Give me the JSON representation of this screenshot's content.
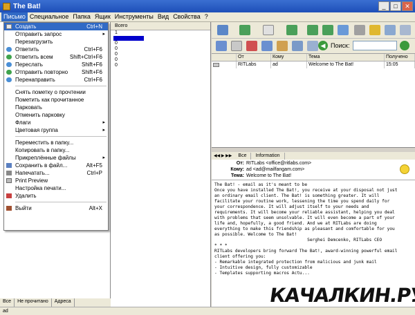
{
  "window": {
    "title": "The Bat!",
    "min": "_",
    "max": "□",
    "close": "✕"
  },
  "menubar": [
    "Письмо",
    "Специальное",
    "Папка",
    "Ящик",
    "Инструменты",
    "Вид",
    "Свойства",
    "?"
  ],
  "context_menu": [
    {
      "label": "Создать",
      "shortcut": "Ctrl+N",
      "icon": "new-message-icon"
    },
    {
      "label": "Отправить запрос",
      "submenu": true
    },
    {
      "label": "Перезагрузить"
    },
    {
      "label": "Ответить",
      "shortcut": "Ctrl+F6",
      "icon": "reply-icon"
    },
    {
      "label": "Ответить всем",
      "shortcut": "Shift+Ctrl+F6",
      "icon": "reply-all-icon"
    },
    {
      "label": "Переслать",
      "shortcut": "Shift+F6",
      "icon": "forward-icon"
    },
    {
      "label": "Отправить повторно",
      "shortcut": "Shift+F6",
      "icon": "resend-icon"
    },
    {
      "label": "Перенаправить",
      "shortcut": "Ctrl+F6",
      "icon": "redirect-icon"
    },
    {
      "sep": true
    },
    {
      "label": "Снять пометку о прочтении"
    },
    {
      "label": "Пометить как прочитанное"
    },
    {
      "label": "Парковать"
    },
    {
      "label": "Отменить парковку"
    },
    {
      "label": "Флаги",
      "submenu": true
    },
    {
      "label": "Цветовая группа",
      "submenu": true
    },
    {
      "sep": true
    },
    {
      "label": "Переместить в папку..."
    },
    {
      "label": "Копировать в папку..."
    },
    {
      "label": "Прикреплённые файлы",
      "submenu": true
    },
    {
      "label": "Сохранить в файл...",
      "shortcut": "Alt+F5",
      "icon": "save-icon"
    },
    {
      "label": "Напечатать...",
      "shortcut": "Ctrl+P",
      "icon": "print-icon"
    },
    {
      "label": "Print Preview"
    },
    {
      "label": "Настройка печати..."
    },
    {
      "label": "Удалить",
      "icon": "delete-icon"
    },
    {
      "sep": true
    },
    {
      "label": "Выйти",
      "shortcut": "Alt+X",
      "icon": "exit-icon"
    }
  ],
  "count_column": {
    "header": "Всего",
    "values": [
      "1",
      "0",
      "0",
      "0",
      "0",
      "0"
    ]
  },
  "search": {
    "label": "Поиск:"
  },
  "message_list": {
    "columns": [
      "",
      "От",
      "Кому",
      "Тема",
      "Получено"
    ],
    "rows": [
      {
        "from": "RITLabs",
        "to": "ad",
        "subject": "Welcome to The Bat!",
        "received": "15:05"
      }
    ]
  },
  "preview_tabs": [
    "Все",
    "Information"
  ],
  "preview_header": [
    {
      "label": "От:",
      "value": "RITLabs <office@ritlabs.com>"
    },
    {
      "label": "Кому:",
      "value": "ad <ad@mailfangam.com>"
    },
    {
      "label": "Тема:",
      "value": "Welcome to The Bat!"
    }
  ],
  "preview_body": [
    "The Bat! - email as it's meant to be",
    "",
    "Once you have installed The Bat!, you receive at your disposal not just",
    "an ordinary email client. The Bat! is something greater. It will",
    "facilitate your routine work, lessening the time you spend daily for",
    "your correspondence. It will adjust itself to your needs and",
    "requirements. It will become your reliable assistant, helping you deal",
    "with problems that seem unsolvable. It will even become a part of your",
    "life and, hopefully, a good friend. And we at RITLabs are doing",
    "everything to make this friendship as pleasant and comfortable for you",
    "as possible. Welcome to The Bat!",
    "",
    "                                    Serghei Demcenko, RITLabs CEO",
    "",
    "* * *",
    "",
    "RITLabs developers bring forward The Bat!, award-winning powerful email",
    "client offering you:",
    "",
    "- Remarkable integrated protection from malicious and junk mail",
    "- Intuitive design, fully customizable",
    "- Templates supporting macros Actu..."
  ],
  "left_tabs": [
    "Все",
    "Не прочитано",
    "Адреса"
  ],
  "status": {
    "text": "ad"
  },
  "watermark": {
    "text": "КАЧАЛКИН.РУ"
  },
  "colors": {
    "title_bar": "#1e4fb8",
    "menu_highlight": "#316ac5",
    "selection": "#0000cc"
  }
}
